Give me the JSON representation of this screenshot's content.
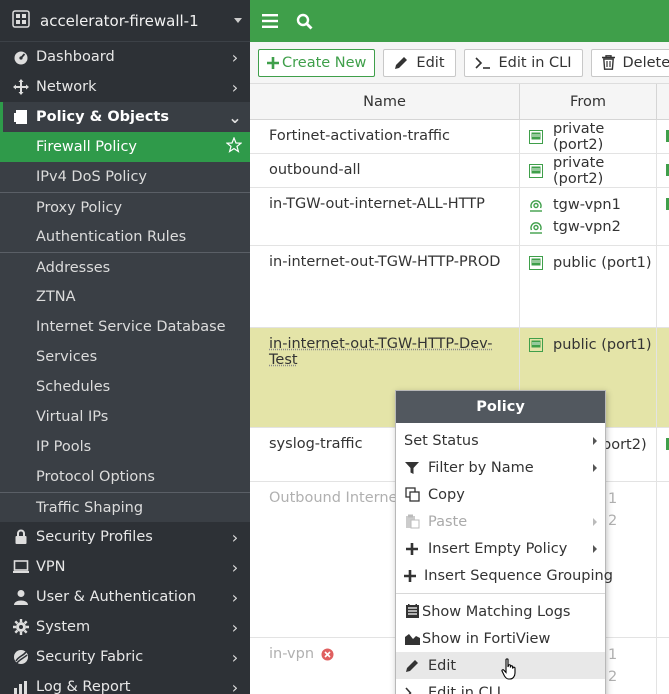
{
  "device": {
    "name": "accelerator-firewall-1"
  },
  "sidebar": {
    "items": [
      {
        "label": "Dashboard",
        "icon": "dashboard-icon"
      },
      {
        "label": "Network",
        "icon": "network-icon"
      },
      {
        "label": "Policy & Objects",
        "icon": "policy-icon",
        "expanded": true
      },
      {
        "label": "Security Profiles",
        "icon": "lock-icon"
      },
      {
        "label": "VPN",
        "icon": "monitor-icon"
      },
      {
        "label": "User & Authentication",
        "icon": "user-icon"
      },
      {
        "label": "System",
        "icon": "gear-icon"
      },
      {
        "label": "Security Fabric",
        "icon": "fabric-icon"
      },
      {
        "label": "Log & Report",
        "icon": "chart-icon"
      }
    ],
    "policy_sub": [
      {
        "label": "Firewall Policy",
        "active": true
      },
      {
        "label": "IPv4 DoS Policy"
      },
      {
        "label": "Proxy Policy"
      },
      {
        "label": "Authentication Rules"
      },
      {
        "label": "Addresses"
      },
      {
        "label": "ZTNA"
      },
      {
        "label": "Internet Service Database"
      },
      {
        "label": "Services"
      },
      {
        "label": "Schedules"
      },
      {
        "label": "Virtual IPs"
      },
      {
        "label": "IP Pools"
      },
      {
        "label": "Protocol Options"
      },
      {
        "label": "Traffic Shaping"
      }
    ]
  },
  "toolbar": {
    "create_new": "Create New",
    "edit": "Edit",
    "edit_in_cli": "Edit in CLI",
    "delete": "Delete"
  },
  "table": {
    "columns": [
      "Name",
      "From"
    ],
    "rows": [
      {
        "name": "Fortinet-activation-traffic",
        "from": [
          "private (port2)"
        ]
      },
      {
        "name": "outbound-all",
        "from": [
          "private (port2)"
        ]
      },
      {
        "name": "in-TGW-out-internet-ALL-HTTP",
        "from": [
          "tgw-vpn1",
          "tgw-vpn2"
        ]
      },
      {
        "name": "in-internet-out-TGW-HTTP-PROD",
        "from": [
          "public (port1)"
        ]
      },
      {
        "name": "in-internet-out-TGW-HTTP-Dev-Test",
        "from": [
          "public (port1)"
        ]
      },
      {
        "name": "syslog-traffic",
        "from": [
          "port2)"
        ]
      },
      {
        "name": "Outbound Internet",
        "from": [
          "1",
          "2"
        ]
      },
      {
        "name": "in-vpn",
        "from": [
          "1",
          "2"
        ]
      }
    ]
  },
  "context_menu": {
    "title": "Policy",
    "items": [
      {
        "label": "Set Status",
        "submenu": true
      },
      {
        "label": "Filter by Name",
        "submenu": true
      },
      {
        "label": "Copy"
      },
      {
        "label": "Paste",
        "submenu": true,
        "disabled": true
      },
      {
        "label": "Insert Empty Policy",
        "submenu": true
      },
      {
        "label": "Insert Sequence Grouping"
      },
      {
        "label": "Show Matching Logs"
      },
      {
        "label": "Show in FortiView"
      },
      {
        "label": "Edit"
      },
      {
        "label": "Edit in CLI"
      }
    ]
  },
  "colors": {
    "accent": "#3f9f4a",
    "sidebar_bg": "#2d3136",
    "selected_row": "#e4e4a8"
  }
}
